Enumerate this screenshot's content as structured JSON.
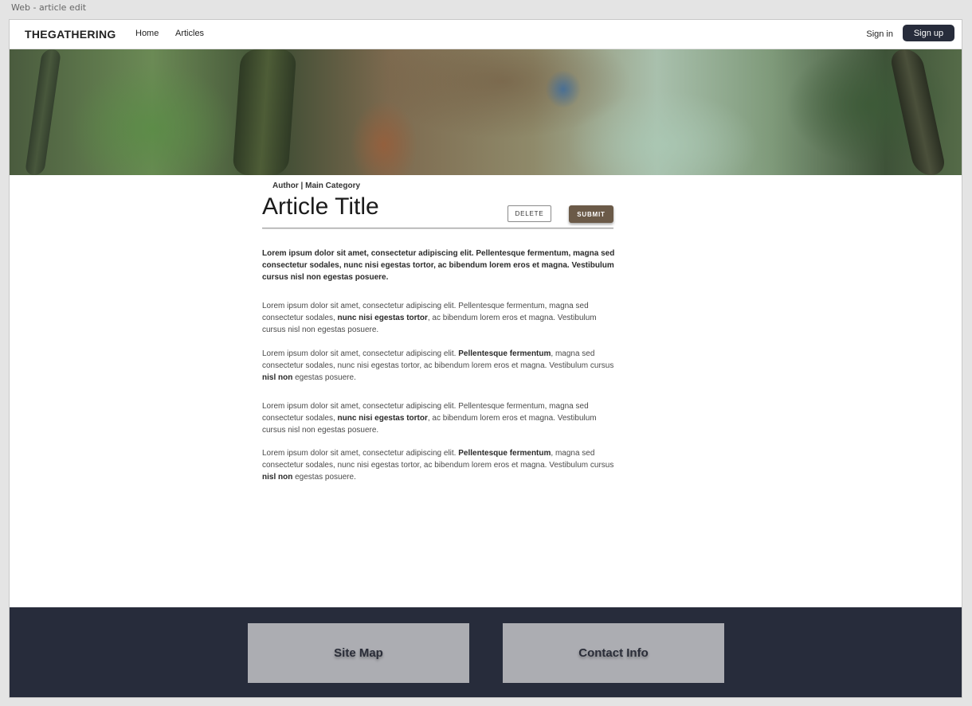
{
  "window": {
    "title": "Web - article edit"
  },
  "nav": {
    "logo": "THEGATHERING",
    "links": [
      "Home",
      "Articles"
    ],
    "signin": "Sign in",
    "signup": "Sign up"
  },
  "article": {
    "meta": "Author | Main Category",
    "title": "Article Title",
    "delete_label": "DELETE",
    "submit_label": "SUBMIT",
    "paragraphs": [
      [
        {
          "t": "Lorem ipsum dolor sit amet, consectetur adipiscing elit. Pellentesque fermentum, magna sed consectetur sodales, nunc nisi egestas tortor, ac bibendum lorem eros et magna. Vestibulum cursus nisl non egestas posuere.",
          "b": false
        }
      ],
      [
        {
          "t": "Lorem ipsum dolor sit amet, consectetur adipiscing elit. Pellentesque fermentum, magna sed consectetur sodales, ",
          "b": false
        },
        {
          "t": "nunc nisi egestas tortor",
          "b": true
        },
        {
          "t": ", ac bibendum lorem eros et magna. Vestibulum cursus nisl non egestas posuere.",
          "b": false
        }
      ],
      [
        {
          "t": "Lorem ipsum dolor sit amet, consectetur adipiscing elit. ",
          "b": false
        },
        {
          "t": "Pellentesque fermentum",
          "b": true
        },
        {
          "t": ", magna sed consectetur sodales, nunc nisi egestas tortor, ac bibendum lorem eros et magna. Vestibulum cursus ",
          "b": false
        },
        {
          "t": "nisl non",
          "b": true
        },
        {
          "t": " egestas posuere.",
          "b": false
        }
      ],
      [
        {
          "t": "Lorem ipsum dolor sit amet, consectetur adipiscing elit. Pellentesque fermentum, magna sed consectetur sodales, ",
          "b": false
        },
        {
          "t": "nunc nisi egestas tortor",
          "b": true
        },
        {
          "t": ", ac bibendum lorem eros et magna. Vestibulum cursus nisl non egestas posuere.",
          "b": false
        }
      ],
      [
        {
          "t": "Lorem ipsum dolor sit amet, consectetur adipiscing elit. ",
          "b": false
        },
        {
          "t": "Pellentesque fermentum",
          "b": true
        },
        {
          "t": ", magna sed consectetur sodales, nunc nisi egestas tortor, ac bibendum lorem eros et magna. Vestibulum cursus ",
          "b": false
        },
        {
          "t": "nisl non",
          "b": true
        },
        {
          "t": " egestas posuere.",
          "b": false
        }
      ]
    ]
  },
  "footer": {
    "site_map": "Site Map",
    "contact_info": "Contact Info"
  },
  "colors": {
    "nav_button": "#272c3b",
    "submit": "#6b5a48",
    "footer_bg": "#272c3b",
    "footer_box": "#acadb2"
  }
}
